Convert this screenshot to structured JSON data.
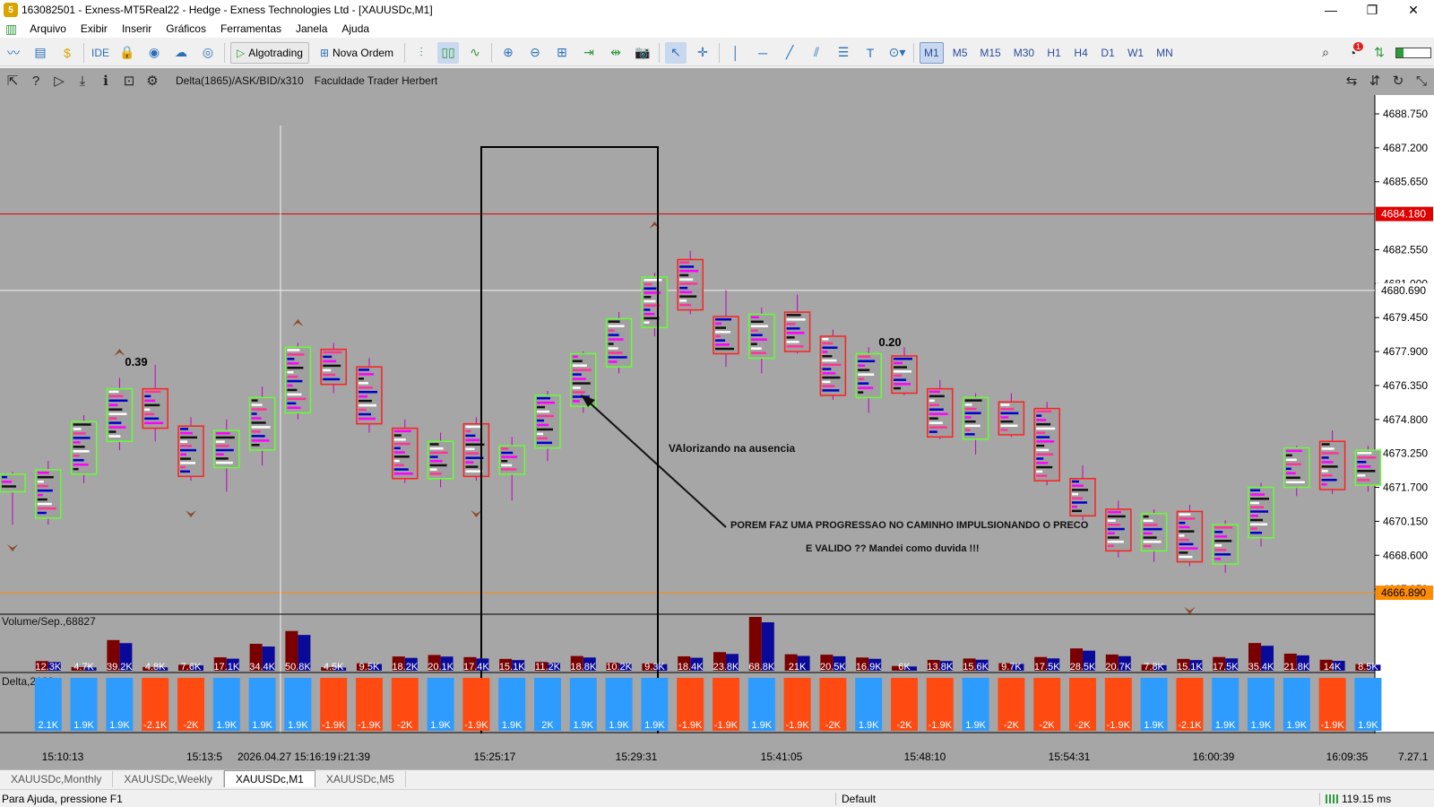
{
  "window": {
    "title": "163082501 - Exness-MT5Real22 - Hedge - Exness Technologies Ltd - [XAUUSDc,M1]",
    "min": "—",
    "restore": "❐",
    "close": "✕"
  },
  "menu": [
    {
      "label": "Arquivo"
    },
    {
      "label": "Exibir"
    },
    {
      "label": "Inserir"
    },
    {
      "label": "Gráficos"
    },
    {
      "label": "Ferramentas"
    },
    {
      "label": "Janela"
    },
    {
      "label": "Ajuda"
    }
  ],
  "toolbar": {
    "ide": "IDE",
    "algotrading": "Algotrading",
    "nova_ordem": "Nova Ordem",
    "timeframes": [
      "M1",
      "M5",
      "M15",
      "M30",
      "H1",
      "H4",
      "D1",
      "W1",
      "MN"
    ],
    "active_timeframe": "M1",
    "notifications": "1"
  },
  "chart_header": {
    "indicator": "Delta(1865)/ASK/BID/x310",
    "label": "Faculdade Trader Herbert"
  },
  "price_axis": {
    "labels": [
      "4688.750",
      "4687.200",
      "4685.650",
      "4682.550",
      "4681.000",
      "4679.450",
      "4677.900",
      "4676.350",
      "4674.800",
      "4673.250",
      "4671.700",
      "4670.150",
      "4668.600",
      "4667.050"
    ],
    "red_line": "4684.180",
    "white_line": "4680.690",
    "orange_line": "4666.890",
    "colors": {
      "red": "#e00000",
      "orange": "#ff8c00",
      "bull": "#66ff33",
      "bear": "#ff2020"
    }
  },
  "annotations": {
    "label_a": "0.39",
    "label_b": "0.20",
    "note1": "VAlorizando na ausencia",
    "note2": "POREM FAZ UMA PROGRESSAO NO CAMINHO IMPULSIONANDO O PRECO",
    "note3": "E VALIDO ?? Mandei como duvida !!!"
  },
  "volume_panel": {
    "title": "Volume/Sep.,68827",
    "values": [
      "12.3K",
      "4.7K",
      "39.2K",
      "4.8K",
      "7.6K",
      "17.1K",
      "34.4K",
      "50.8K",
      "4.5K",
      "9.5K",
      "18.2K",
      "20.1K",
      "17.4K",
      "15.1K",
      "11.2K",
      "18.8K",
      "10.2K",
      "9.3K",
      "18.4K",
      "23.8K",
      "68.8K",
      "21K",
      "20.5K",
      "16.9K",
      "6K",
      "13.8K",
      "15.6K",
      "9.7K",
      "17.5K",
      "28.5K",
      "20.7K",
      "7.8K",
      "15.1K",
      "17.5K",
      "35.4K",
      "21.8K",
      "14K",
      "8.5K"
    ]
  },
  "delta_panel": {
    "title": "Delta,2109",
    "values": [
      "2.1K",
      "1.9K",
      "1.9K",
      "-2.1K",
      "-2K",
      "1.9K",
      "1.9K",
      "1.9K",
      "-1.9K",
      "-1.9K",
      "-2K",
      "1.9K",
      "-1.9K",
      "1.9K",
      "2K",
      "1.9K",
      "1.9K",
      "1.9K",
      "-1.9K",
      "-1.9K",
      "1.9K",
      "-1.9K",
      "-2K",
      "1.9K",
      "-2K",
      "-1.9K",
      "1.9K",
      "-2K",
      "-2K",
      "-2K",
      "-1.9K",
      "1.9K",
      "-2.1K",
      "1.9K",
      "1.9K",
      "1.9K",
      "-1.9K",
      "1.9K"
    ]
  },
  "time_axis": {
    "labels": [
      "15:10:13",
      "15:13:5",
      "2026.04.27 15:16:19",
      "i:21:39",
      "15:25:17",
      "15:29:31",
      "15:41:05",
      "15:48:10",
      "15:54:31",
      "16:00:39",
      "16:09:35"
    ],
    "right": "7.27.1"
  },
  "tabs": [
    {
      "label": "XAUUSDc,Monthly"
    },
    {
      "label": "XAUUSDc,Weekly"
    },
    {
      "label": "XAUUSDc,M1"
    },
    {
      "label": "XAUUSDc,M5"
    }
  ],
  "active_tab": "XAUUSDc,M1",
  "status": {
    "help": "Para Ajuda, pressione F1",
    "profile": "Default",
    "ping": "119.15 ms"
  },
  "chart_data": {
    "type": "bar",
    "categories": [
      "15:10:13",
      "",
      "",
      "",
      "",
      "",
      "",
      "",
      "",
      "",
      "",
      "",
      "",
      "15:25:17",
      "",
      "",
      "",
      "15:29:31",
      "",
      "",
      "",
      "",
      "",
      "15:41:05",
      "",
      "",
      "15:48:10",
      "",
      "",
      "15:54:31",
      "",
      "",
      "",
      "16:00:39",
      "",
      "",
      "",
      "16:09:35"
    ],
    "series": [
      {
        "name": "Volume/Sep.,68827",
        "values": [
          12.3,
          4.7,
          39.2,
          4.8,
          7.6,
          17.1,
          34.4,
          50.8,
          4.5,
          9.5,
          18.2,
          20.1,
          17.4,
          15.1,
          11.2,
          18.8,
          10.2,
          9.3,
          18.4,
          23.8,
          68.8,
          21,
          20.5,
          16.9,
          6,
          13.8,
          15.6,
          9.7,
          17.5,
          28.5,
          20.7,
          7.8,
          15.1,
          17.5,
          35.4,
          21.8,
          14,
          8.5
        ]
      },
      {
        "name": "Delta,2109",
        "values": [
          2.1,
          1.9,
          1.9,
          -2.1,
          -2,
          1.9,
          1.9,
          1.9,
          -1.9,
          -1.9,
          -2,
          1.9,
          -1.9,
          1.9,
          2,
          1.9,
          1.9,
          1.9,
          -1.9,
          -1.9,
          1.9,
          -1.9,
          -2,
          1.9,
          -2,
          -1.9,
          1.9,
          -2,
          -2,
          -2,
          -1.9,
          1.9,
          -2.1,
          1.9,
          1.9,
          1.9,
          -1.9,
          1.9
        ]
      }
    ],
    "candles": [
      {
        "o": 4671.5,
        "h": 4672.4,
        "l": 4670.0,
        "c": 4672.3
      },
      {
        "o": 4670.3,
        "h": 4672.9,
        "l": 4670.0,
        "c": 4672.5
      },
      {
        "o": 4672.3,
        "h": 4675.0,
        "l": 4671.9,
        "c": 4674.7
      },
      {
        "o": 4673.8,
        "h": 4676.7,
        "l": 4673.4,
        "c": 4676.2
      },
      {
        "o": 4676.2,
        "h": 4677.3,
        "l": 4673.8,
        "c": 4674.4
      },
      {
        "o": 4674.5,
        "h": 4674.9,
        "l": 4672.0,
        "c": 4672.2
      },
      {
        "o": 4672.6,
        "h": 4674.8,
        "l": 4671.5,
        "c": 4674.3
      },
      {
        "o": 4673.4,
        "h": 4676.3,
        "l": 4672.7,
        "c": 4675.8
      },
      {
        "o": 4675.1,
        "h": 4678.3,
        "l": 4674.8,
        "c": 4678.1
      },
      {
        "o": 4678.0,
        "h": 4678.3,
        "l": 4676.0,
        "c": 4676.4
      },
      {
        "o": 4677.2,
        "h": 4677.6,
        "l": 4674.2,
        "c": 4674.6
      },
      {
        "o": 4674.4,
        "h": 4674.8,
        "l": 4671.9,
        "c": 4672.1
      },
      {
        "o": 4672.1,
        "h": 4674.2,
        "l": 4671.7,
        "c": 4673.8
      },
      {
        "o": 4674.6,
        "h": 4674.9,
        "l": 4672.0,
        "c": 4672.2
      },
      {
        "o": 4672.3,
        "h": 4674.0,
        "l": 4671.1,
        "c": 4673.6
      },
      {
        "o": 4673.5,
        "h": 4676.1,
        "l": 4672.9,
        "c": 4675.9
      },
      {
        "o": 4675.4,
        "h": 4677.9,
        "l": 4675.1,
        "c": 4677.8
      },
      {
        "o": 4677.2,
        "h": 4679.7,
        "l": 4676.9,
        "c": 4679.4
      },
      {
        "o": 4679.0,
        "h": 4681.5,
        "l": 4678.6,
        "c": 4681.3
      },
      {
        "o": 4682.1,
        "h": 4682.5,
        "l": 4679.6,
        "c": 4679.8
      },
      {
        "o": 4679.5,
        "h": 4680.7,
        "l": 4677.2,
        "c": 4677.8
      },
      {
        "o": 4677.6,
        "h": 4679.9,
        "l": 4676.9,
        "c": 4679.6
      },
      {
        "o": 4679.7,
        "h": 4680.5,
        "l": 4677.8,
        "c": 4677.9
      },
      {
        "o": 4678.6,
        "h": 4678.9,
        "l": 4675.7,
        "c": 4675.9
      },
      {
        "o": 4675.8,
        "h": 4678.1,
        "l": 4675.1,
        "c": 4677.8
      },
      {
        "o": 4677.7,
        "h": 4678.1,
        "l": 4675.9,
        "c": 4676.0
      },
      {
        "o": 4676.2,
        "h": 4676.6,
        "l": 4673.9,
        "c": 4674.0
      },
      {
        "o": 4673.9,
        "h": 4676.0,
        "l": 4673.2,
        "c": 4675.8
      },
      {
        "o": 4675.6,
        "h": 4676.0,
        "l": 4674.0,
        "c": 4674.1
      },
      {
        "o": 4675.3,
        "h": 4675.6,
        "l": 4671.8,
        "c": 4672.0
      },
      {
        "o": 4672.1,
        "h": 4672.7,
        "l": 4670.2,
        "c": 4670.4
      },
      {
        "o": 4670.7,
        "h": 4671.1,
        "l": 4668.5,
        "c": 4668.8
      },
      {
        "o": 4668.8,
        "h": 4670.7,
        "l": 4668.3,
        "c": 4670.5
      },
      {
        "o": 4670.6,
        "h": 4670.9,
        "l": 4668.1,
        "c": 4668.3
      },
      {
        "o": 4668.2,
        "h": 4670.2,
        "l": 4667.8,
        "c": 4670.0
      },
      {
        "o": 4669.4,
        "h": 4671.9,
        "l": 4669.0,
        "c": 4671.7
      },
      {
        "o": 4671.7,
        "h": 4673.6,
        "l": 4671.3,
        "c": 4673.5
      },
      {
        "o": 4673.8,
        "h": 4674.3,
        "l": 4671.4,
        "c": 4671.6
      },
      {
        "o": 4671.8,
        "h": 4673.6,
        "l": 4671.5,
        "c": 4673.4
      }
    ],
    "ylim": [
      4666.4,
      4689.2
    ]
  }
}
